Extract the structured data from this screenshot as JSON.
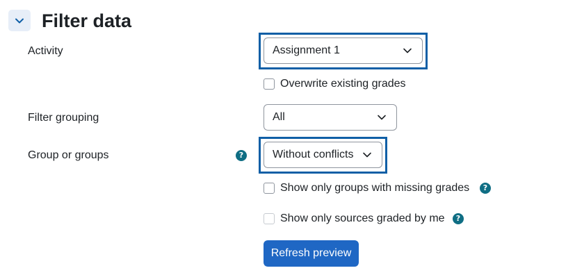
{
  "section": {
    "title": "Filter data",
    "collapse_icon": "chevron-down-icon"
  },
  "activity": {
    "label": "Activity",
    "selected": "Assignment 1"
  },
  "overwrite": {
    "label": "Overwrite existing grades",
    "checked": false
  },
  "filter_grouping": {
    "label": "Filter grouping",
    "selected": "All"
  },
  "groups": {
    "label": "Group or groups",
    "selected": "Without conflicts",
    "help_icon": "help-icon"
  },
  "missing_grades": {
    "label": "Show only groups with missing grades",
    "checked": false,
    "help_icon": "help-icon"
  },
  "graded_by_me": {
    "label": "Show only sources graded by me",
    "checked": false,
    "disabled": true,
    "help_icon": "help-icon"
  },
  "refresh": {
    "label": "Refresh preview"
  },
  "colors": {
    "primary": "#1f67c4",
    "help": "#0f6e84",
    "focus": "#0f5fa6"
  }
}
